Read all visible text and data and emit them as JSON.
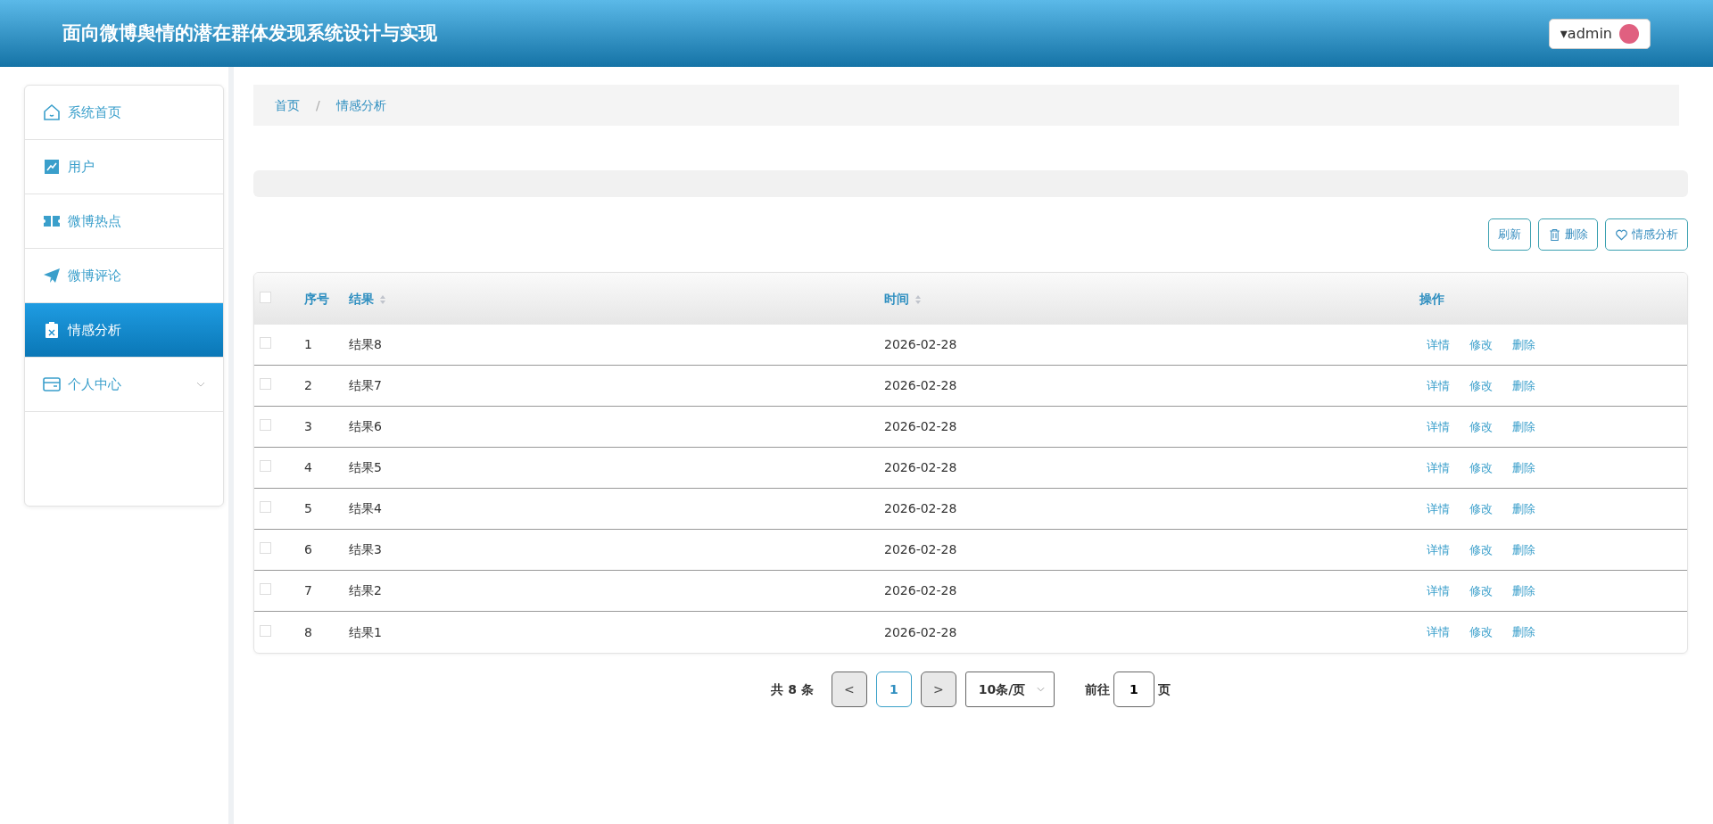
{
  "header": {
    "title": "面向微博舆情的潜在群体发现系统设计与实现",
    "user": {
      "name": "admin",
      "caret": "▾"
    }
  },
  "sidebar": {
    "items": [
      {
        "label": "系统首页",
        "kind": "home",
        "selected": false,
        "submenu": false
      },
      {
        "label": "用户",
        "kind": "chart",
        "selected": false,
        "submenu": false
      },
      {
        "label": "微博热点",
        "kind": "ticket",
        "selected": false,
        "submenu": false
      },
      {
        "label": "微博评论",
        "kind": "plane",
        "selected": false,
        "submenu": false
      },
      {
        "label": "情感分析",
        "kind": "clipboard",
        "selected": true,
        "submenu": false
      },
      {
        "label": "个人中心",
        "kind": "card",
        "selected": false,
        "submenu": true
      }
    ]
  },
  "breadcrumb": {
    "separator": "/",
    "items": [
      {
        "label": "首页"
      },
      {
        "label": "情感分析"
      }
    ]
  },
  "toolbar": {
    "buttons": [
      {
        "label": "刷新",
        "kind": "plain"
      },
      {
        "label": "删除",
        "kind": "trash"
      },
      {
        "label": "情感分析",
        "kind": "heart"
      }
    ]
  },
  "table": {
    "select_all": {
      "checked": false
    },
    "columns": [
      {
        "label": "序号",
        "sortable": false
      },
      {
        "label": "结果",
        "sortable": true
      },
      {
        "label": "时间",
        "sortable": true
      },
      {
        "label": "操作",
        "sortable": false
      }
    ],
    "rows": [
      {
        "checked": false,
        "index": "1",
        "result": "结果8",
        "time": "2026-02-28",
        "actions": [
          "详情",
          "修改",
          "删除"
        ]
      },
      {
        "checked": false,
        "index": "2",
        "result": "结果7",
        "time": "2026-02-28",
        "actions": [
          "详情",
          "修改",
          "删除"
        ]
      },
      {
        "checked": false,
        "index": "3",
        "result": "结果6",
        "time": "2026-02-28",
        "actions": [
          "详情",
          "修改",
          "删除"
        ]
      },
      {
        "checked": false,
        "index": "4",
        "result": "结果5",
        "time": "2026-02-28",
        "actions": [
          "详情",
          "修改",
          "删除"
        ]
      },
      {
        "checked": false,
        "index": "5",
        "result": "结果4",
        "time": "2026-02-28",
        "actions": [
          "详情",
          "修改",
          "删除"
        ]
      },
      {
        "checked": false,
        "index": "6",
        "result": "结果3",
        "time": "2026-02-28",
        "actions": [
          "详情",
          "修改",
          "删除"
        ]
      },
      {
        "checked": false,
        "index": "7",
        "result": "结果2",
        "time": "2026-02-28",
        "actions": [
          "详情",
          "修改",
          "删除"
        ]
      },
      {
        "checked": false,
        "index": "8",
        "result": "结果1",
        "time": "2026-02-28",
        "actions": [
          "详情",
          "修改",
          "删除"
        ]
      }
    ]
  },
  "pagination": {
    "total": "共 **8** 条",
    "prev": "<",
    "pages": [
      {
        "label": "1",
        "selected": true
      }
    ],
    "next": ">",
    "page_size": "10条/页",
    "goto_label": "前往",
    "goto_value": "1",
    "goto_suffix": "页"
  }
}
